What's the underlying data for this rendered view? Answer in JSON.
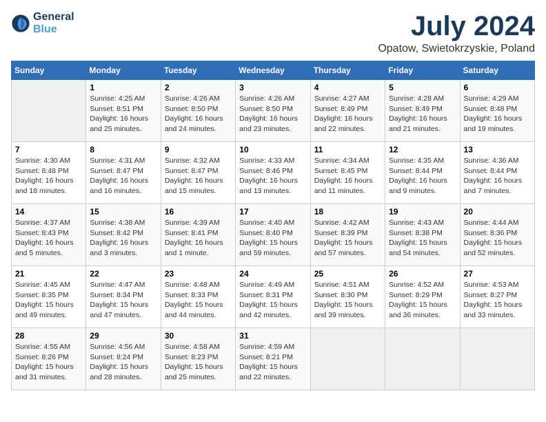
{
  "header": {
    "logo_line1": "General",
    "logo_line2": "Blue",
    "month": "July 2024",
    "location": "Opatow, Swietokrzyskie, Poland"
  },
  "weekdays": [
    "Sunday",
    "Monday",
    "Tuesday",
    "Wednesday",
    "Thursday",
    "Friday",
    "Saturday"
  ],
  "weeks": [
    [
      {
        "day": "",
        "info": ""
      },
      {
        "day": "1",
        "info": "Sunrise: 4:25 AM\nSunset: 8:51 PM\nDaylight: 16 hours\nand 25 minutes."
      },
      {
        "day": "2",
        "info": "Sunrise: 4:26 AM\nSunset: 8:50 PM\nDaylight: 16 hours\nand 24 minutes."
      },
      {
        "day": "3",
        "info": "Sunrise: 4:26 AM\nSunset: 8:50 PM\nDaylight: 16 hours\nand 23 minutes."
      },
      {
        "day": "4",
        "info": "Sunrise: 4:27 AM\nSunset: 8:49 PM\nDaylight: 16 hours\nand 22 minutes."
      },
      {
        "day": "5",
        "info": "Sunrise: 4:28 AM\nSunset: 8:49 PM\nDaylight: 16 hours\nand 21 minutes."
      },
      {
        "day": "6",
        "info": "Sunrise: 4:29 AM\nSunset: 8:48 PM\nDaylight: 16 hours\nand 19 minutes."
      }
    ],
    [
      {
        "day": "7",
        "info": "Sunrise: 4:30 AM\nSunset: 8:48 PM\nDaylight: 16 hours\nand 18 minutes."
      },
      {
        "day": "8",
        "info": "Sunrise: 4:31 AM\nSunset: 8:47 PM\nDaylight: 16 hours\nand 16 minutes."
      },
      {
        "day": "9",
        "info": "Sunrise: 4:32 AM\nSunset: 8:47 PM\nDaylight: 16 hours\nand 15 minutes."
      },
      {
        "day": "10",
        "info": "Sunrise: 4:33 AM\nSunset: 8:46 PM\nDaylight: 16 hours\nand 13 minutes."
      },
      {
        "day": "11",
        "info": "Sunrise: 4:34 AM\nSunset: 8:45 PM\nDaylight: 16 hours\nand 11 minutes."
      },
      {
        "day": "12",
        "info": "Sunrise: 4:35 AM\nSunset: 8:44 PM\nDaylight: 16 hours\nand 9 minutes."
      },
      {
        "day": "13",
        "info": "Sunrise: 4:36 AM\nSunset: 8:44 PM\nDaylight: 16 hours\nand 7 minutes."
      }
    ],
    [
      {
        "day": "14",
        "info": "Sunrise: 4:37 AM\nSunset: 8:43 PM\nDaylight: 16 hours\nand 5 minutes."
      },
      {
        "day": "15",
        "info": "Sunrise: 4:38 AM\nSunset: 8:42 PM\nDaylight: 16 hours\nand 3 minutes."
      },
      {
        "day": "16",
        "info": "Sunrise: 4:39 AM\nSunset: 8:41 PM\nDaylight: 16 hours\nand 1 minute."
      },
      {
        "day": "17",
        "info": "Sunrise: 4:40 AM\nSunset: 8:40 PM\nDaylight: 15 hours\nand 59 minutes."
      },
      {
        "day": "18",
        "info": "Sunrise: 4:42 AM\nSunset: 8:39 PM\nDaylight: 15 hours\nand 57 minutes."
      },
      {
        "day": "19",
        "info": "Sunrise: 4:43 AM\nSunset: 8:38 PM\nDaylight: 15 hours\nand 54 minutes."
      },
      {
        "day": "20",
        "info": "Sunrise: 4:44 AM\nSunset: 8:36 PM\nDaylight: 15 hours\nand 52 minutes."
      }
    ],
    [
      {
        "day": "21",
        "info": "Sunrise: 4:45 AM\nSunset: 8:35 PM\nDaylight: 15 hours\nand 49 minutes."
      },
      {
        "day": "22",
        "info": "Sunrise: 4:47 AM\nSunset: 8:34 PM\nDaylight: 15 hours\nand 47 minutes."
      },
      {
        "day": "23",
        "info": "Sunrise: 4:48 AM\nSunset: 8:33 PM\nDaylight: 15 hours\nand 44 minutes."
      },
      {
        "day": "24",
        "info": "Sunrise: 4:49 AM\nSunset: 8:31 PM\nDaylight: 15 hours\nand 42 minutes."
      },
      {
        "day": "25",
        "info": "Sunrise: 4:51 AM\nSunset: 8:30 PM\nDaylight: 15 hours\nand 39 minutes."
      },
      {
        "day": "26",
        "info": "Sunrise: 4:52 AM\nSunset: 8:29 PM\nDaylight: 15 hours\nand 36 minutes."
      },
      {
        "day": "27",
        "info": "Sunrise: 4:53 AM\nSunset: 8:27 PM\nDaylight: 15 hours\nand 33 minutes."
      }
    ],
    [
      {
        "day": "28",
        "info": "Sunrise: 4:55 AM\nSunset: 8:26 PM\nDaylight: 15 hours\nand 31 minutes."
      },
      {
        "day": "29",
        "info": "Sunrise: 4:56 AM\nSunset: 8:24 PM\nDaylight: 15 hours\nand 28 minutes."
      },
      {
        "day": "30",
        "info": "Sunrise: 4:58 AM\nSunset: 8:23 PM\nDaylight: 15 hours\nand 25 minutes."
      },
      {
        "day": "31",
        "info": "Sunrise: 4:59 AM\nSunset: 8:21 PM\nDaylight: 15 hours\nand 22 minutes."
      },
      {
        "day": "",
        "info": ""
      },
      {
        "day": "",
        "info": ""
      },
      {
        "day": "",
        "info": ""
      }
    ]
  ]
}
